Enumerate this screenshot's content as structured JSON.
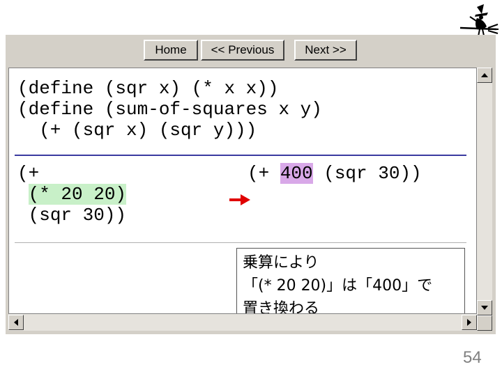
{
  "toolbar": {
    "home_label": "Home",
    "previous_label": "<< Previous",
    "next_label": "Next >>"
  },
  "code": {
    "line1": "(define (sqr x) (* x x))",
    "line2": "(define (sum-of-squares x y)",
    "line3": "  (+ (sqr x) (sqr y)))",
    "left_open": "(+",
    "left_expr": "(* 20 20)",
    "left_last": "(sqr 30))",
    "right_prefix": "(+ ",
    "right_value": "400",
    "right_suffix": " (sqr 30))"
  },
  "callout": {
    "line1": "乗算により",
    "line2": "「(* 20 20)」は「400」で",
    "line3": "置き換わる"
  },
  "page_number": "54",
  "colors": {
    "green_highlight": "#c8f0c8",
    "purple_highlight": "#d8a8e8",
    "arrow": "#e00000",
    "separator": "#3a3aa0"
  },
  "icons": {
    "logo": "witch-on-broom-icon",
    "arrow": "right-arrow-icon"
  }
}
